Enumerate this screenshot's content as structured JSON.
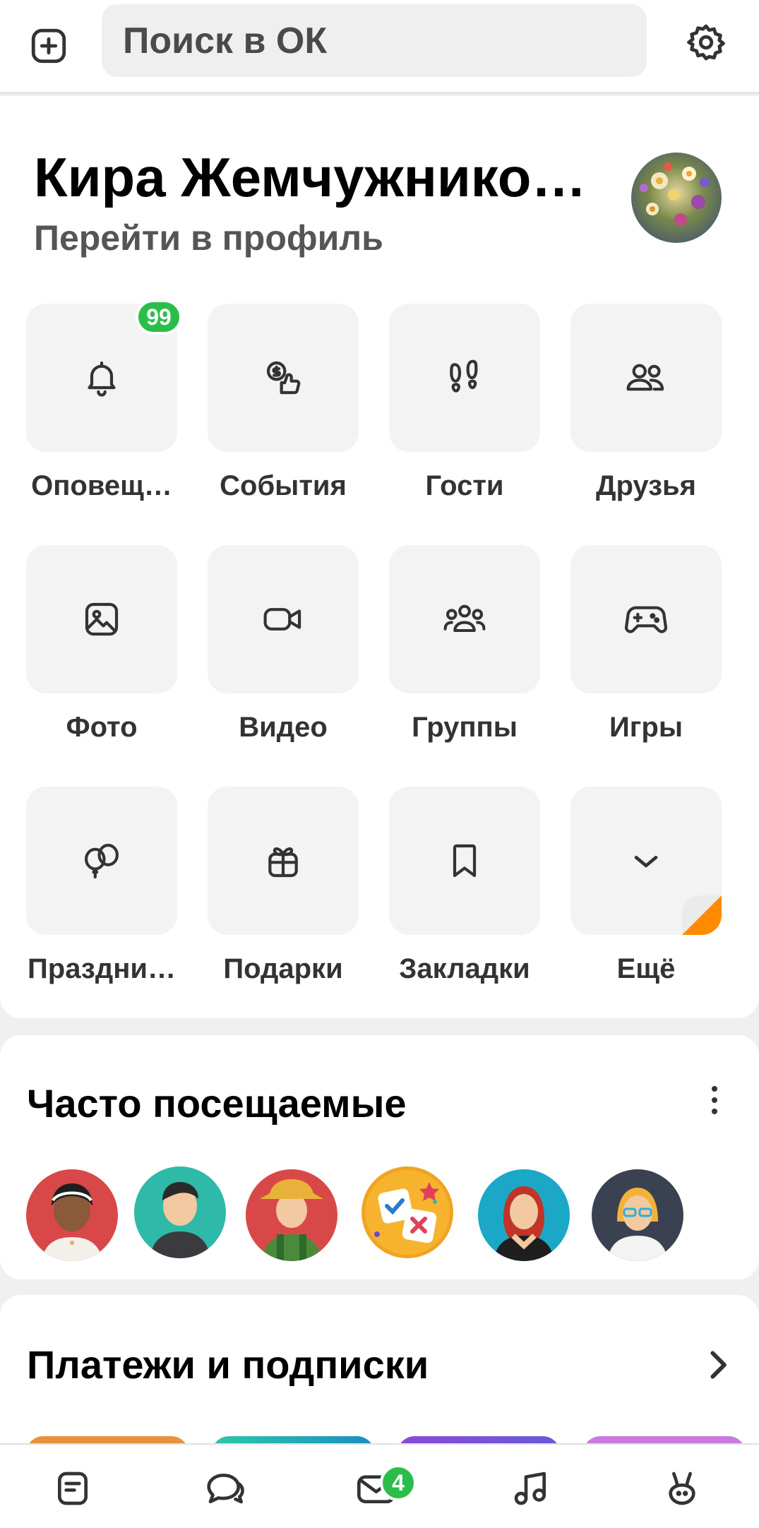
{
  "topbar": {
    "search_placeholder": "Поиск в ОК"
  },
  "profile": {
    "name": "Кира Жемчужнико…",
    "link": "Перейти в профиль"
  },
  "tiles": [
    {
      "label": "Оповещ…",
      "icon": "bell-icon"
    },
    {
      "label": "События",
      "icon": "events-icon"
    },
    {
      "label": "Гости",
      "icon": "footprints-icon"
    },
    {
      "label": "Друзья",
      "icon": "friends-icon"
    },
    {
      "label": "Фото",
      "icon": "photo-icon"
    },
    {
      "label": "Видео",
      "icon": "video-icon"
    },
    {
      "label": "Группы",
      "icon": "groups-icon"
    },
    {
      "label": "Игры",
      "icon": "gamepad-icon"
    },
    {
      "label": "Праздни…",
      "icon": "balloons-icon"
    },
    {
      "label": "Подарки",
      "icon": "gift-icon"
    },
    {
      "label": "Закладки",
      "icon": "bookmark-icon"
    },
    {
      "label": "Ещё",
      "icon": "chevron-down-icon"
    }
  ],
  "notifications_badge": "99",
  "frequent": {
    "title": "Часто посещаемые"
  },
  "payments": {
    "title": "Платежи и подписки"
  },
  "nav": {
    "messages_badge": "4"
  },
  "colors": {
    "accent_green": "#2bbd4a",
    "accent_orange": "#ff8a00"
  }
}
